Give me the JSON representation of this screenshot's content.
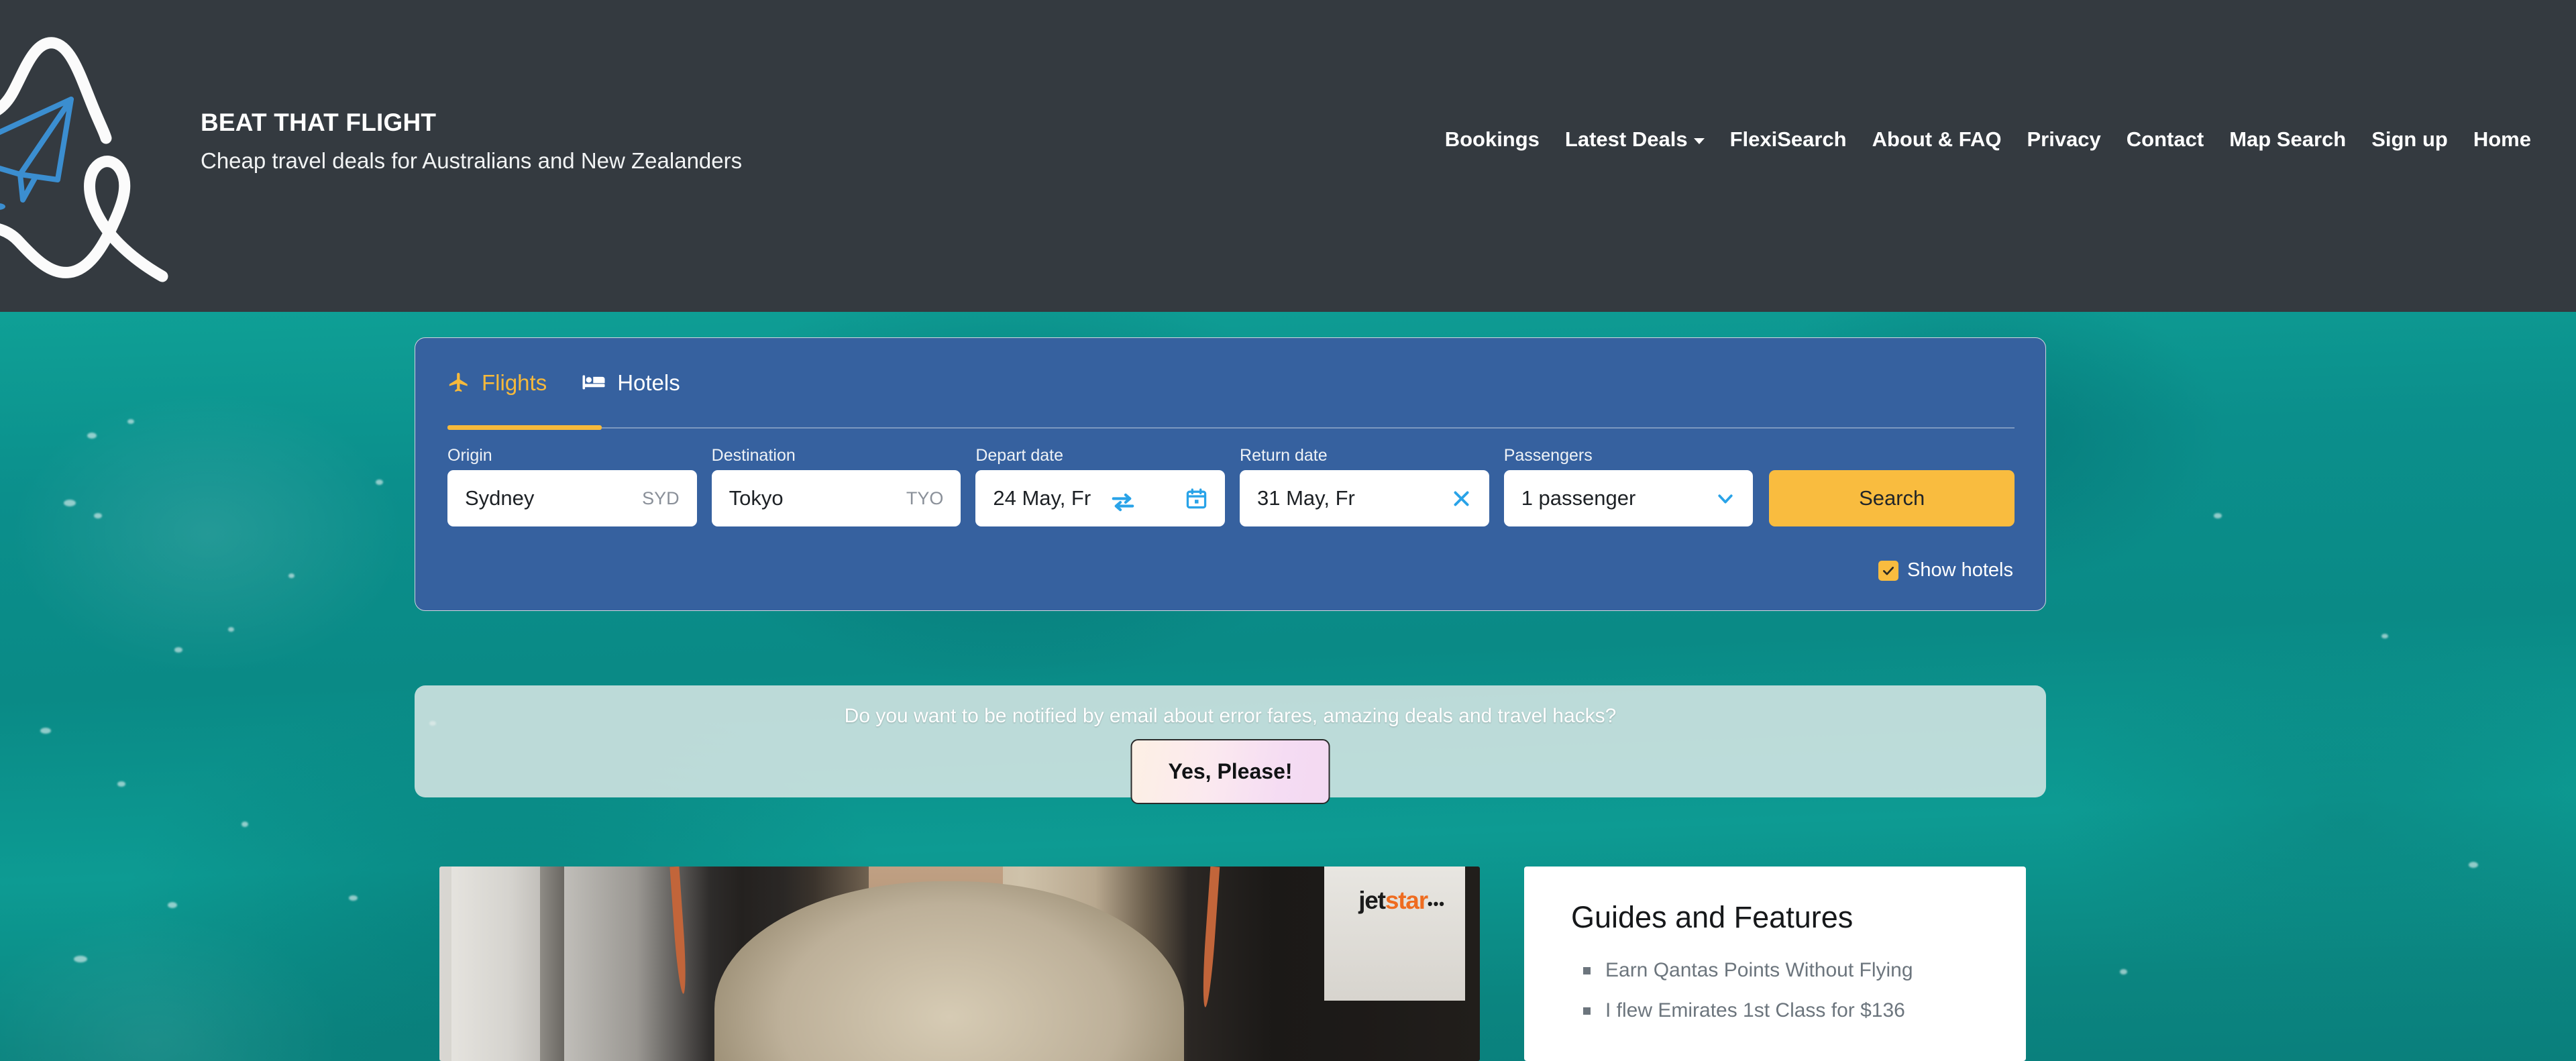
{
  "header": {
    "brand_title": "BEAT THAT FLIGHT",
    "brand_tagline": "Cheap travel deals for Australians and New Zealanders",
    "logo_icon": "paper-plane-icon",
    "nav": [
      {
        "label": "Bookings",
        "has_caret": false
      },
      {
        "label": "Latest Deals",
        "has_caret": true
      },
      {
        "label": "FlexiSearch",
        "has_caret": false
      },
      {
        "label": "About & FAQ",
        "has_caret": false
      },
      {
        "label": "Privacy",
        "has_caret": false
      },
      {
        "label": "Contact",
        "has_caret": false
      },
      {
        "label": "Map Search",
        "has_caret": false
      },
      {
        "label": "Sign up",
        "has_caret": false
      },
      {
        "label": "Home",
        "has_caret": false
      }
    ]
  },
  "search": {
    "tabs": [
      {
        "label": "Flights",
        "icon": "airplane-icon",
        "active": true
      },
      {
        "label": "Hotels",
        "icon": "bed-icon",
        "active": false
      }
    ],
    "origin": {
      "label": "Origin",
      "value": "Sydney",
      "code": "SYD"
    },
    "destination": {
      "label": "Destination",
      "value": "Tokyo",
      "code": "TYO"
    },
    "depart": {
      "label": "Depart date",
      "value": "24 May, Fr",
      "icon": "calendar-icon"
    },
    "return": {
      "label": "Return date",
      "value": "31 May, Fr",
      "icon": "clear-x-icon"
    },
    "passengers": {
      "label": "Passengers",
      "value": "1 passenger",
      "icon": "chevron-down-icon"
    },
    "swap_icon": "swap-arrows-icon",
    "search_button": "Search",
    "show_hotels": {
      "label": "Show hotels",
      "checked": true,
      "check_glyph": "✔"
    }
  },
  "newsletter": {
    "message": "Do you want to be notified by email about error fares, amazing deals and travel hacks?",
    "cta_label": "Yes, Please!"
  },
  "article": {
    "airline_logo_jet": "jet",
    "airline_logo_star": "star",
    "airline_logo_dots": "•••"
  },
  "guides": {
    "title": "Guides and Features",
    "items": [
      "Earn Qantas Points Without Flying",
      "I flew Emirates 1st Class for $136"
    ]
  },
  "colors": {
    "header_bg": "#343a40",
    "ocean_bg": "#0b8f8c",
    "card_blue": "#36619f",
    "accent_orange": "#f6b93b",
    "search_button": "#f9bc3f",
    "logo_blue": "#3b8ed0",
    "muted_text": "#6c757d",
    "jetstar_orange": "#ef6c20"
  }
}
